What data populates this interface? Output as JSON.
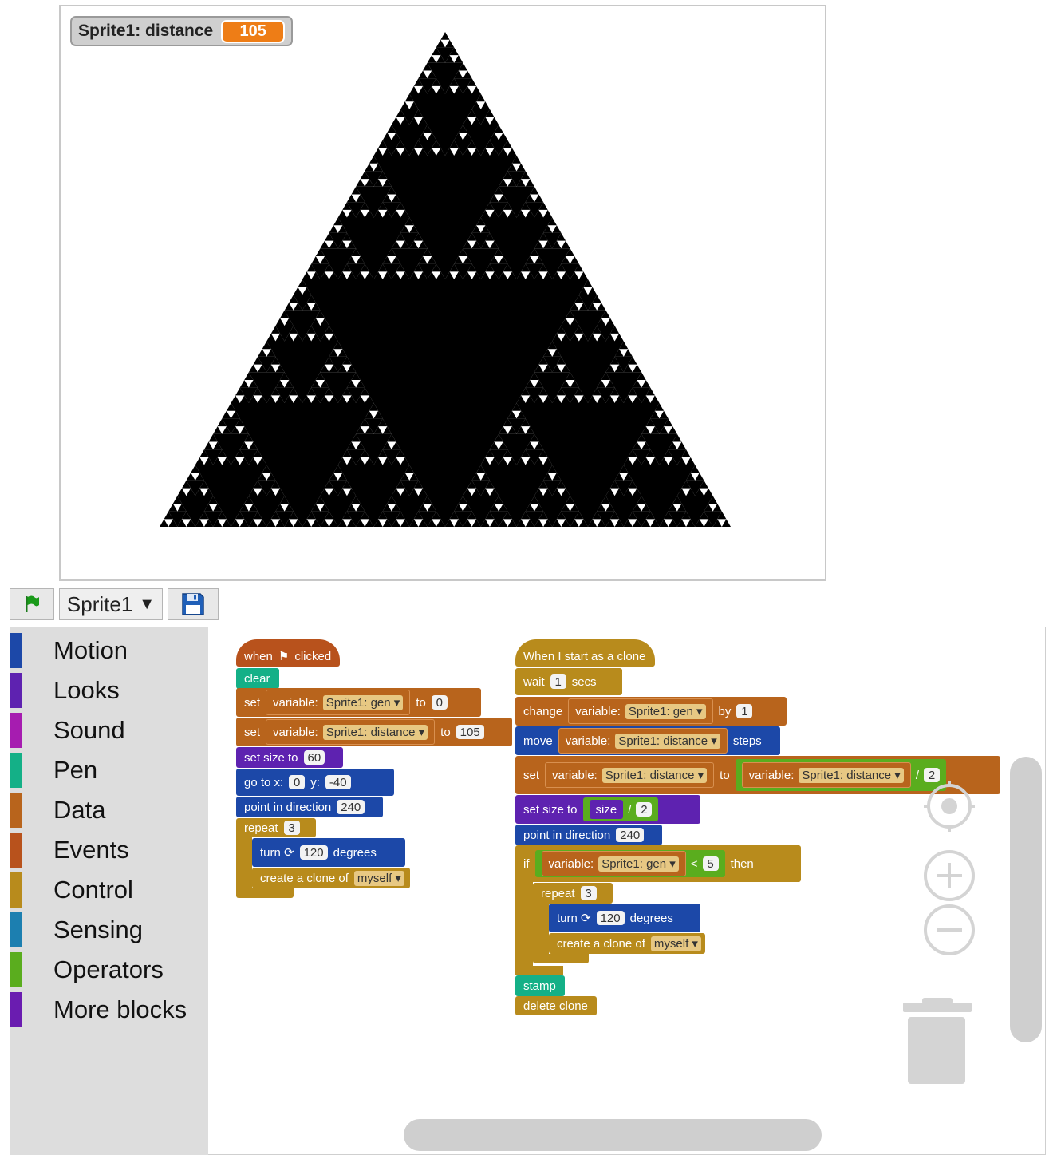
{
  "stage": {
    "monitor": {
      "label": "Sprite1: distance",
      "value": "105"
    }
  },
  "toolbar": {
    "flag_icon": "green-flag-icon",
    "sprite_name": "Sprite1",
    "dropdown_arrow": "▼",
    "save_icon": "floppy-disk-icon"
  },
  "palette": {
    "categories": [
      {
        "label": "Motion",
        "color": "#1c48a8"
      },
      {
        "label": "Looks",
        "color": "#5e22b0"
      },
      {
        "label": "Sound",
        "color": "#a61cb0"
      },
      {
        "label": "Pen",
        "color": "#14b087"
      },
      {
        "label": "Data",
        "color": "#b8641c"
      },
      {
        "label": "Events",
        "color": "#b8521c"
      },
      {
        "label": "Control",
        "color": "#b88b1c"
      },
      {
        "label": "Sensing",
        "color": "#1c7fb0"
      },
      {
        "label": "Operators",
        "color": "#5aad1e"
      },
      {
        "label": "More blocks",
        "color": "#6a1cb0"
      }
    ]
  },
  "script1": {
    "when": "when",
    "flag": "⚑",
    "clicked": "clicked",
    "clear": "clear",
    "set1": {
      "set": "set",
      "var": "variable:",
      "name": "Sprite1: gen ▾",
      "to": "to",
      "value": "0"
    },
    "set2": {
      "set": "set",
      "var": "variable:",
      "name": "Sprite1: distance ▾",
      "to": "to",
      "value": "105"
    },
    "size": {
      "label": "set size to",
      "value": "60"
    },
    "goto": {
      "label": "go to x:",
      "x": "0",
      "ylabel": "y:",
      "y": "-40"
    },
    "dir": {
      "label": "point in direction",
      "value": "240"
    },
    "repeat": {
      "label": "repeat",
      "value": "3"
    },
    "turn": {
      "label": "turn ⟳",
      "value": "120",
      "unit": "degrees"
    },
    "clone": {
      "label": "create a clone of",
      "target": "myself ▾"
    }
  },
  "script2": {
    "hat": "When I start as a clone",
    "wait": {
      "label": "wait",
      "value": "1",
      "unit": "secs"
    },
    "change": {
      "label": "change",
      "var": "variable:",
      "name": "Sprite1: gen ▾",
      "by": "by",
      "value": "1"
    },
    "move": {
      "label": "move",
      "var": "variable:",
      "name": "Sprite1: distance ▾",
      "unit": "steps"
    },
    "set": {
      "label": "set",
      "var": "variable:",
      "name": "Sprite1: distance ▾",
      "to": "to",
      "var2": "variable:",
      "name2": "Sprite1: distance ▾",
      "op": "/",
      "value": "2"
    },
    "size": {
      "label": "set size to",
      "reporter": "size",
      "op": "/",
      "value": "2"
    },
    "dir": {
      "label": "point in direction",
      "value": "240"
    },
    "if": {
      "label": "if",
      "var": "variable:",
      "name": "Sprite1: gen ▾",
      "op": "<",
      "value": "5",
      "then": "then"
    },
    "repeat": {
      "label": "repeat",
      "value": "3"
    },
    "turn": {
      "label": "turn ⟳",
      "value": "120",
      "unit": "degrees"
    },
    "clone": {
      "label": "create a clone of",
      "target": "myself ▾"
    },
    "stamp": "stamp",
    "delete": "delete clone"
  },
  "workspace_controls": {
    "recenter_icon": "recenter-icon",
    "zoom_in_icon": "zoom-in-icon",
    "zoom_out_icon": "zoom-out-icon",
    "trash_icon": "trash-can-icon"
  }
}
